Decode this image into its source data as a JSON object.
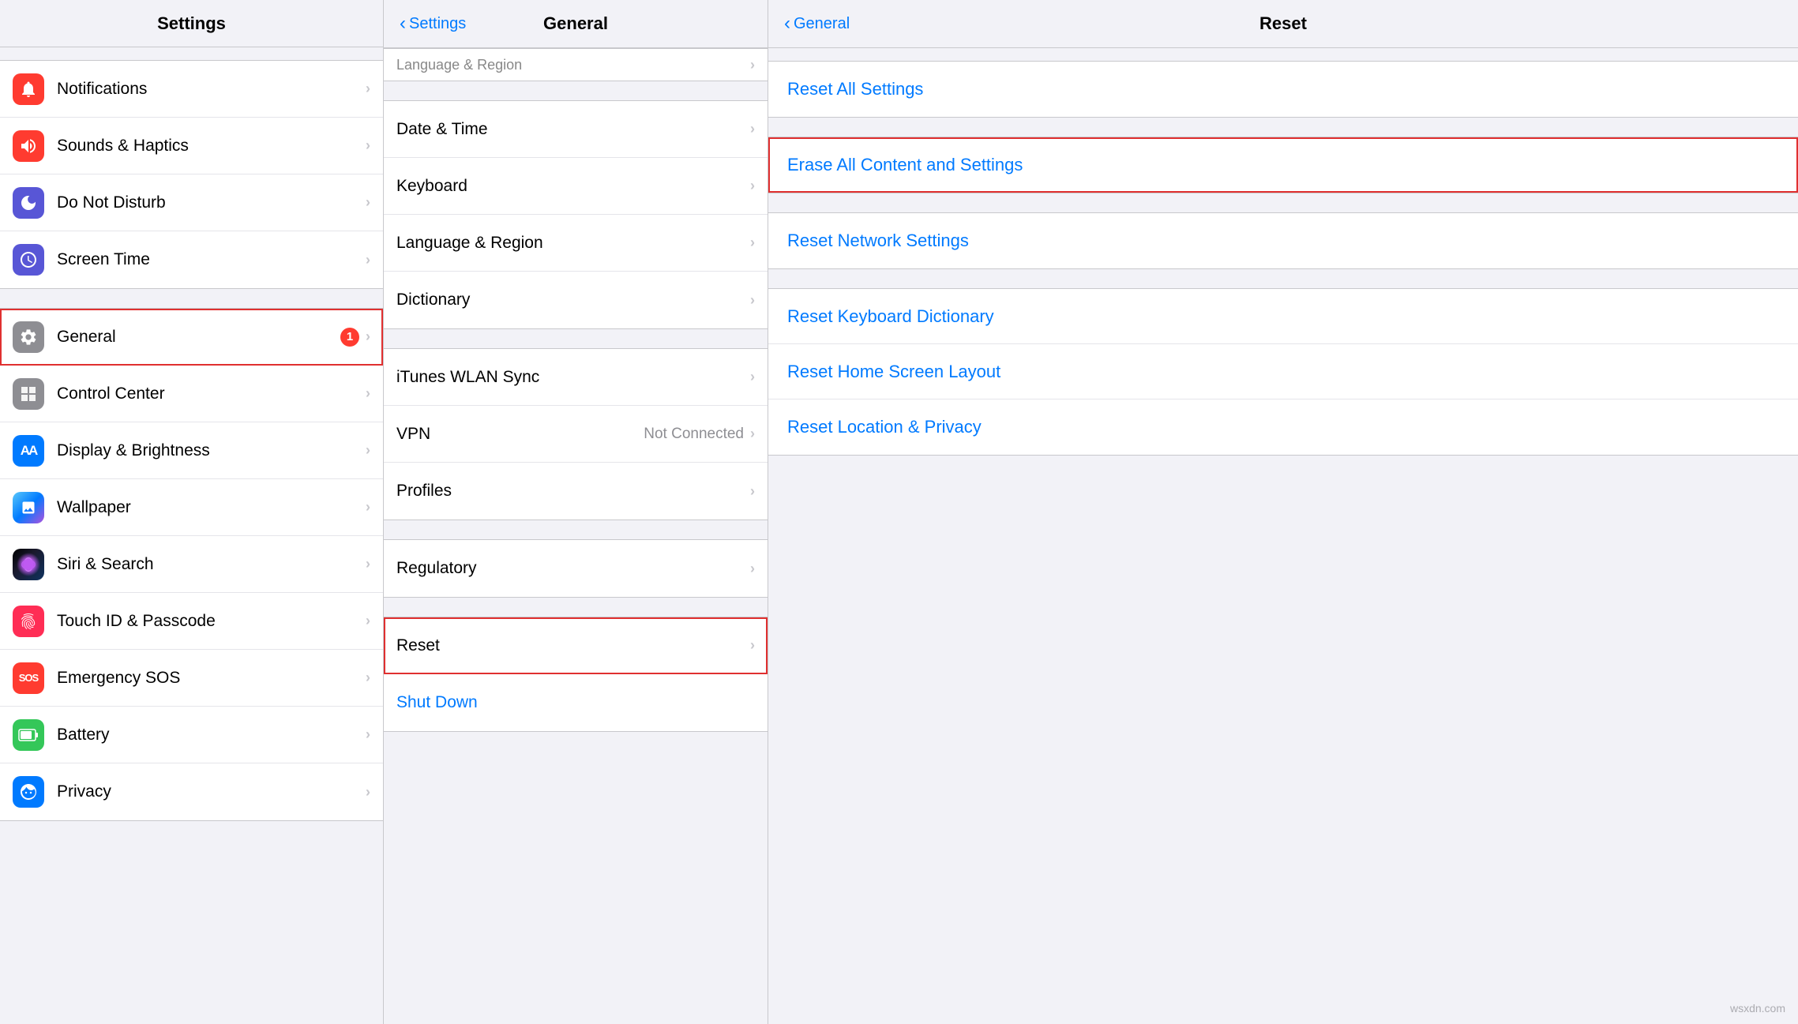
{
  "columns": {
    "left": {
      "title": "Settings",
      "sections": [
        {
          "items": [
            {
              "id": "notifications",
              "label": "Notifications",
              "iconBg": "icon-red",
              "iconChar": "🔔"
            },
            {
              "id": "sounds",
              "label": "Sounds & Haptics",
              "iconBg": "icon-red2",
              "iconChar": "🔊"
            },
            {
              "id": "donotdisturb",
              "label": "Do Not Disturb",
              "iconBg": "icon-indigo",
              "iconChar": "🌙"
            },
            {
              "id": "screentime",
              "label": "Screen Time",
              "iconBg": "icon-indigo",
              "iconChar": "⏳"
            }
          ]
        },
        {
          "items": [
            {
              "id": "general",
              "label": "General",
              "iconBg": "icon-gray",
              "iconChar": "⚙️",
              "badge": "1",
              "highlighted": true
            },
            {
              "id": "controlcenter",
              "label": "Control Center",
              "iconBg": "icon-gray",
              "iconChar": "⊞"
            },
            {
              "id": "displaybrightness",
              "label": "Display & Brightness",
              "iconBg": "icon-blue",
              "iconChar": "AA"
            },
            {
              "id": "wallpaper",
              "label": "Wallpaper",
              "iconBg": "icon-teal",
              "iconChar": "🌸"
            },
            {
              "id": "siri",
              "label": "Siri & Search",
              "iconBg": "icon-siri",
              "iconChar": ""
            },
            {
              "id": "touchid",
              "label": "Touch ID & Passcode",
              "iconBg": "icon-pink",
              "iconChar": "👆"
            },
            {
              "id": "emergencysos",
              "label": "Emergency SOS",
              "iconBg": "icon-sos",
              "iconChar": "SOS"
            },
            {
              "id": "battery",
              "label": "Battery",
              "iconBg": "icon-green",
              "iconChar": "🔋"
            },
            {
              "id": "privacy",
              "label": "Privacy",
              "iconBg": "icon-blue",
              "iconChar": "✋"
            }
          ]
        }
      ]
    },
    "middle": {
      "title": "General",
      "backLabel": "Settings",
      "sections": [
        {
          "items": [
            {
              "id": "datetime",
              "label": "Date & Time"
            },
            {
              "id": "keyboard",
              "label": "Keyboard"
            },
            {
              "id": "language",
              "label": "Language & Region"
            },
            {
              "id": "dictionary",
              "label": "Dictionary"
            }
          ]
        },
        {
          "items": [
            {
              "id": "itunes",
              "label": "iTunes WLAN Sync"
            },
            {
              "id": "vpn",
              "label": "VPN",
              "value": "Not Connected"
            },
            {
              "id": "profiles",
              "label": "Profiles"
            }
          ]
        },
        {
          "items": [
            {
              "id": "regulatory",
              "label": "Regulatory"
            }
          ]
        },
        {
          "items": [
            {
              "id": "reset",
              "label": "Reset",
              "highlighted": true
            },
            {
              "id": "shutdown",
              "label": "Shut Down",
              "isBlue": true
            }
          ]
        }
      ]
    },
    "right": {
      "title": "Reset",
      "backLabel": "General",
      "sections": [
        {
          "items": [
            {
              "id": "reset-all-settings",
              "label": "Reset All Settings"
            }
          ]
        },
        {
          "items": [
            {
              "id": "erase-all",
              "label": "Erase All Content and Settings",
              "highlighted": true
            }
          ]
        },
        {
          "items": [
            {
              "id": "reset-network",
              "label": "Reset Network Settings"
            }
          ]
        },
        {
          "items": [
            {
              "id": "reset-keyboard",
              "label": "Reset Keyboard Dictionary"
            },
            {
              "id": "reset-homescreen",
              "label": "Reset Home Screen Layout"
            },
            {
              "id": "reset-location",
              "label": "Reset Location & Privacy"
            }
          ]
        }
      ]
    }
  },
  "watermark": "wsxdn.com"
}
